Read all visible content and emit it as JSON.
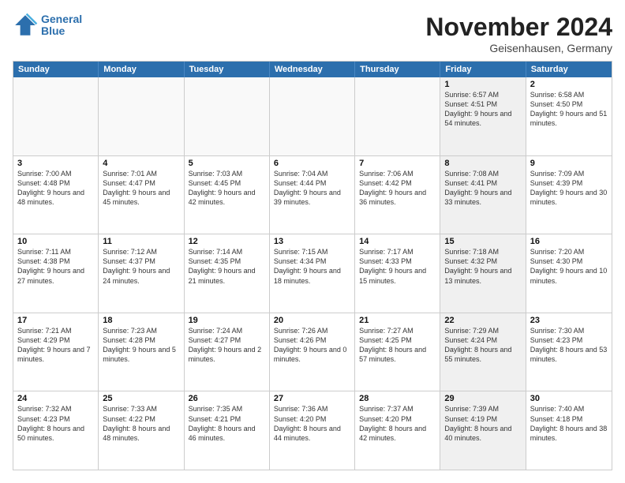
{
  "logo": {
    "line1": "General",
    "line2": "Blue"
  },
  "title": "November 2024",
  "location": "Geisenhausen, Germany",
  "days_of_week": [
    "Sunday",
    "Monday",
    "Tuesday",
    "Wednesday",
    "Thursday",
    "Friday",
    "Saturday"
  ],
  "rows": [
    [
      {
        "day": "",
        "text": "",
        "empty": true
      },
      {
        "day": "",
        "text": "",
        "empty": true
      },
      {
        "day": "",
        "text": "",
        "empty": true
      },
      {
        "day": "",
        "text": "",
        "empty": true
      },
      {
        "day": "",
        "text": "",
        "empty": true
      },
      {
        "day": "1",
        "text": "Sunrise: 6:57 AM\nSunset: 4:51 PM\nDaylight: 9 hours and 54 minutes.",
        "shaded": true
      },
      {
        "day": "2",
        "text": "Sunrise: 6:58 AM\nSunset: 4:50 PM\nDaylight: 9 hours and 51 minutes.",
        "shaded": false
      }
    ],
    [
      {
        "day": "3",
        "text": "Sunrise: 7:00 AM\nSunset: 4:48 PM\nDaylight: 9 hours and 48 minutes.",
        "shaded": false
      },
      {
        "day": "4",
        "text": "Sunrise: 7:01 AM\nSunset: 4:47 PM\nDaylight: 9 hours and 45 minutes.",
        "shaded": false
      },
      {
        "day": "5",
        "text": "Sunrise: 7:03 AM\nSunset: 4:45 PM\nDaylight: 9 hours and 42 minutes.",
        "shaded": false
      },
      {
        "day": "6",
        "text": "Sunrise: 7:04 AM\nSunset: 4:44 PM\nDaylight: 9 hours and 39 minutes.",
        "shaded": false
      },
      {
        "day": "7",
        "text": "Sunrise: 7:06 AM\nSunset: 4:42 PM\nDaylight: 9 hours and 36 minutes.",
        "shaded": false
      },
      {
        "day": "8",
        "text": "Sunrise: 7:08 AM\nSunset: 4:41 PM\nDaylight: 9 hours and 33 minutes.",
        "shaded": true
      },
      {
        "day": "9",
        "text": "Sunrise: 7:09 AM\nSunset: 4:39 PM\nDaylight: 9 hours and 30 minutes.",
        "shaded": false
      }
    ],
    [
      {
        "day": "10",
        "text": "Sunrise: 7:11 AM\nSunset: 4:38 PM\nDaylight: 9 hours and 27 minutes.",
        "shaded": false
      },
      {
        "day": "11",
        "text": "Sunrise: 7:12 AM\nSunset: 4:37 PM\nDaylight: 9 hours and 24 minutes.",
        "shaded": false
      },
      {
        "day": "12",
        "text": "Sunrise: 7:14 AM\nSunset: 4:35 PM\nDaylight: 9 hours and 21 minutes.",
        "shaded": false
      },
      {
        "day": "13",
        "text": "Sunrise: 7:15 AM\nSunset: 4:34 PM\nDaylight: 9 hours and 18 minutes.",
        "shaded": false
      },
      {
        "day": "14",
        "text": "Sunrise: 7:17 AM\nSunset: 4:33 PM\nDaylight: 9 hours and 15 minutes.",
        "shaded": false
      },
      {
        "day": "15",
        "text": "Sunrise: 7:18 AM\nSunset: 4:32 PM\nDaylight: 9 hours and 13 minutes.",
        "shaded": true
      },
      {
        "day": "16",
        "text": "Sunrise: 7:20 AM\nSunset: 4:30 PM\nDaylight: 9 hours and 10 minutes.",
        "shaded": false
      }
    ],
    [
      {
        "day": "17",
        "text": "Sunrise: 7:21 AM\nSunset: 4:29 PM\nDaylight: 9 hours and 7 minutes.",
        "shaded": false
      },
      {
        "day": "18",
        "text": "Sunrise: 7:23 AM\nSunset: 4:28 PM\nDaylight: 9 hours and 5 minutes.",
        "shaded": false
      },
      {
        "day": "19",
        "text": "Sunrise: 7:24 AM\nSunset: 4:27 PM\nDaylight: 9 hours and 2 minutes.",
        "shaded": false
      },
      {
        "day": "20",
        "text": "Sunrise: 7:26 AM\nSunset: 4:26 PM\nDaylight: 9 hours and 0 minutes.",
        "shaded": false
      },
      {
        "day": "21",
        "text": "Sunrise: 7:27 AM\nSunset: 4:25 PM\nDaylight: 8 hours and 57 minutes.",
        "shaded": false
      },
      {
        "day": "22",
        "text": "Sunrise: 7:29 AM\nSunset: 4:24 PM\nDaylight: 8 hours and 55 minutes.",
        "shaded": true
      },
      {
        "day": "23",
        "text": "Sunrise: 7:30 AM\nSunset: 4:23 PM\nDaylight: 8 hours and 53 minutes.",
        "shaded": false
      }
    ],
    [
      {
        "day": "24",
        "text": "Sunrise: 7:32 AM\nSunset: 4:23 PM\nDaylight: 8 hours and 50 minutes.",
        "shaded": false
      },
      {
        "day": "25",
        "text": "Sunrise: 7:33 AM\nSunset: 4:22 PM\nDaylight: 8 hours and 48 minutes.",
        "shaded": false
      },
      {
        "day": "26",
        "text": "Sunrise: 7:35 AM\nSunset: 4:21 PM\nDaylight: 8 hours and 46 minutes.",
        "shaded": false
      },
      {
        "day": "27",
        "text": "Sunrise: 7:36 AM\nSunset: 4:20 PM\nDaylight: 8 hours and 44 minutes.",
        "shaded": false
      },
      {
        "day": "28",
        "text": "Sunrise: 7:37 AM\nSunset: 4:20 PM\nDaylight: 8 hours and 42 minutes.",
        "shaded": false
      },
      {
        "day": "29",
        "text": "Sunrise: 7:39 AM\nSunset: 4:19 PM\nDaylight: 8 hours and 40 minutes.",
        "shaded": true
      },
      {
        "day": "30",
        "text": "Sunrise: 7:40 AM\nSunset: 4:18 PM\nDaylight: 8 hours and 38 minutes.",
        "shaded": false
      }
    ]
  ]
}
